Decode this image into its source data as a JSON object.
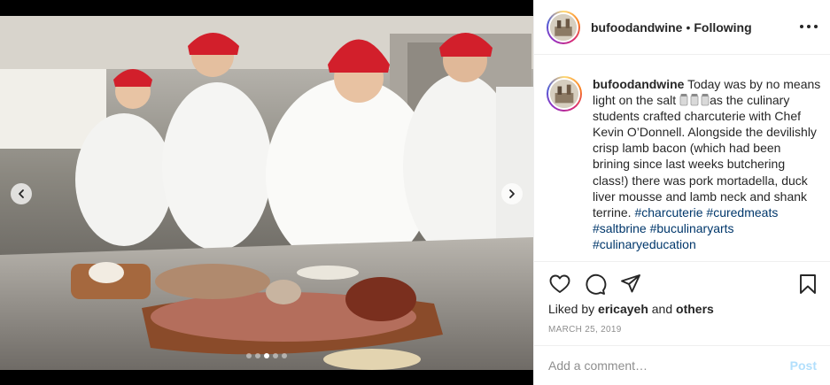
{
  "post": {
    "username": "bufoodandwine",
    "separator": "•",
    "follow_status": "Following",
    "caption": {
      "username": "bufoodandwine",
      "text_before_icon": "Today was by no means light on the salt",
      "salt_icon": "salt-shaker-icons",
      "text_after_icon": "as the culinary students crafted charcuterie with Chef Kevin O’Donnell. Alongside the devilishly crisp lamb bacon (which had been brining since last weeks butchering class!) there was pork mortadella, duck liver mousse and lamb neck and shank terrine.",
      "hashtags": [
        "#charcuterie",
        "#curedmeats",
        "#saltbrine",
        "#buculinaryarts",
        "#culinaryeducation"
      ]
    },
    "likes": {
      "prefix": "Liked by",
      "user": "ericayeh",
      "conjunction": "and",
      "others": "others"
    },
    "date": "MARCH 25, 2019",
    "comment": {
      "placeholder": "Add a comment…",
      "post_label": "Post"
    },
    "carousel": {
      "slide_count": 5,
      "active_index": 2
    },
    "colors": {
      "hashtag": "#00376b",
      "post_button": "#b2dffc",
      "muted": "#8e8e8e",
      "text": "#262626"
    }
  }
}
